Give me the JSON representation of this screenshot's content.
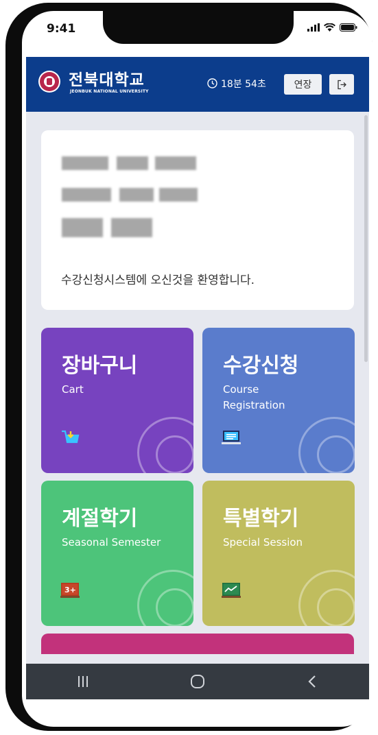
{
  "status_bar": {
    "time": "9:41",
    "icons": [
      "signal-icon",
      "wifi-icon",
      "battery-icon"
    ]
  },
  "header": {
    "university_name": "전북대학교",
    "university_name_en": "JEONBUK NATIONAL UNIVERSITY",
    "timer": "18분 54초",
    "extend_label": "연장",
    "logout_icon": "logout-icon",
    "brand_color": "#0c3d8c"
  },
  "welcome": {
    "message": "수강신청시스템에 오신것을 환영합니다."
  },
  "menu_tiles": [
    {
      "title": "장바구니",
      "subtitle": "Cart",
      "icon": "cart-icon",
      "color": "#7743bf"
    },
    {
      "title": "수강신청",
      "subtitle": "Course Registration",
      "icon": "computer-icon",
      "color": "#5a7ccc"
    },
    {
      "title": "계절학기",
      "subtitle": "Seasonal Semester",
      "icon": "blackboard-icon",
      "color": "#4dc47a"
    },
    {
      "title": "특별학기",
      "subtitle": "Special Session",
      "icon": "chart-board-icon",
      "color": "#c0bd5e"
    },
    {
      "title": "",
      "subtitle": "",
      "icon": "",
      "color": "#c2327b"
    }
  ],
  "nav_bar": {
    "buttons": [
      "recent-apps-icon",
      "home-icon",
      "back-icon"
    ]
  }
}
